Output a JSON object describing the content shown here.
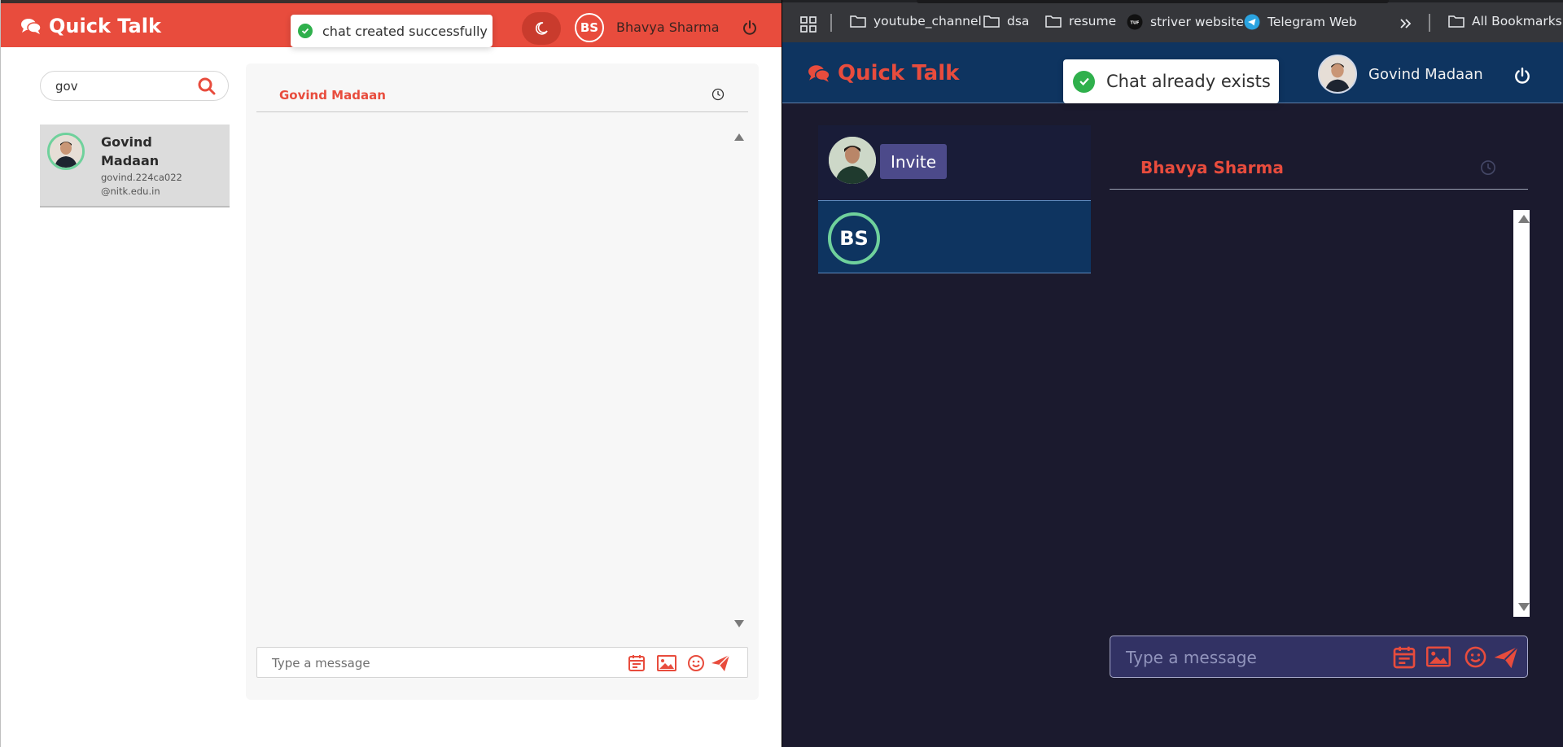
{
  "colors": {
    "accent": "#e84c3d",
    "success": "#2fb04c",
    "online_ring": "#6fd19c",
    "dark_bg": "#1b1a2e",
    "dark_header": "#0e3460"
  },
  "left": {
    "brand": "Quick Talk",
    "toast": "chat created successfully",
    "user_initials": "BS",
    "user_name": "Bhavya Sharma",
    "search_value": "gov",
    "result": {
      "name": "Govind Madaan",
      "email": "govind.224ca022@nitk.edu.in"
    },
    "chat_title": "Govind Madaan",
    "composer_placeholder": "Type a message"
  },
  "right": {
    "bookmarks": [
      {
        "label": "youtube_channel",
        "icon": "folder-icon"
      },
      {
        "label": "dsa",
        "icon": "folder-icon"
      },
      {
        "label": "resume",
        "icon": "folder-icon"
      },
      {
        "label": "striver website",
        "icon": "tuf-icon"
      },
      {
        "label": "Telegram Web",
        "icon": "telegram-icon"
      }
    ],
    "all_bookmarks": "All Bookmarks",
    "brand": "Quick Talk",
    "toast": "Chat already exists",
    "user_name": "Govind Madaan",
    "invite_label": "Invite",
    "bs_initials": "BS",
    "chat_title": "Bhavya Sharma",
    "composer_placeholder": "Type a message"
  }
}
